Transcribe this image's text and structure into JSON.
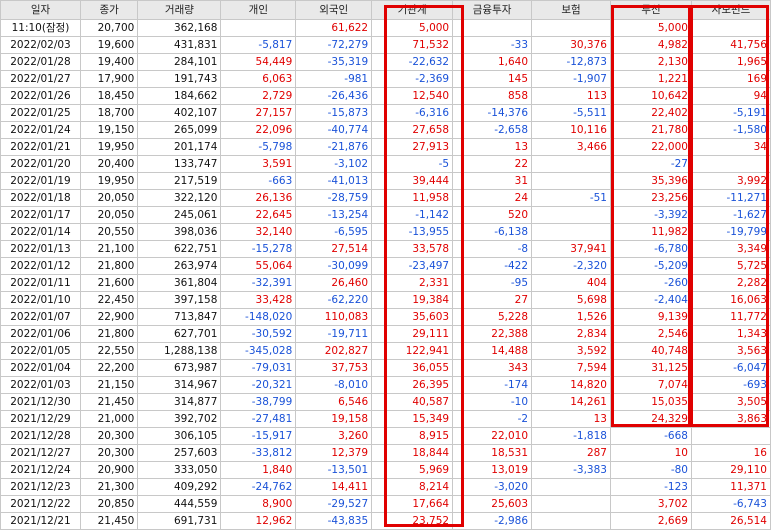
{
  "columns": [
    "일자",
    "종가",
    "거래량",
    "개인",
    "외국인",
    "기관계",
    "금융투자",
    "보험",
    "투신",
    "사모펀드"
  ],
  "rows": [
    [
      "11:10(잠정)",
      "20,700",
      "362,168",
      "",
      "61,622",
      "5,000",
      "",
      "",
      "5,000",
      ""
    ],
    [
      "2022/02/03",
      "19,600",
      "431,831",
      "-5,817",
      "-72,279",
      "71,532",
      "-33",
      "30,376",
      "4,982",
      "41,756"
    ],
    [
      "2022/01/28",
      "19,400",
      "284,101",
      "54,449",
      "-35,319",
      "-22,632",
      "1,640",
      "-12,873",
      "2,130",
      "1,965"
    ],
    [
      "2022/01/27",
      "17,900",
      "191,743",
      "6,063",
      "-981",
      "-2,369",
      "145",
      "-1,907",
      "1,221",
      "169"
    ],
    [
      "2022/01/26",
      "18,450",
      "184,662",
      "2,729",
      "-26,436",
      "12,540",
      "858",
      "113",
      "10,642",
      "94"
    ],
    [
      "2022/01/25",
      "18,700",
      "402,107",
      "27,157",
      "-15,873",
      "-6,316",
      "-14,376",
      "-5,511",
      "22,402",
      "-5,191"
    ],
    [
      "2022/01/24",
      "19,150",
      "265,099",
      "22,096",
      "-40,774",
      "27,658",
      "-2,658",
      "10,116",
      "21,780",
      "-1,580"
    ],
    [
      "2022/01/21",
      "19,950",
      "201,174",
      "-5,798",
      "-21,876",
      "27,913",
      "13",
      "3,466",
      "22,000",
      "34"
    ],
    [
      "2022/01/20",
      "20,400",
      "133,747",
      "3,591",
      "-3,102",
      "-5",
      "22",
      "",
      "-27",
      ""
    ],
    [
      "2022/01/19",
      "19,950",
      "217,519",
      "-663",
      "-41,013",
      "39,444",
      "31",
      "",
      "35,396",
      "3,992"
    ],
    [
      "2022/01/18",
      "20,050",
      "322,120",
      "26,136",
      "-28,759",
      "11,958",
      "24",
      "-51",
      "23,256",
      "-11,271"
    ],
    [
      "2022/01/17",
      "20,050",
      "245,061",
      "22,645",
      "-13,254",
      "-1,142",
      "520",
      "",
      "-3,392",
      "-1,627"
    ],
    [
      "2022/01/14",
      "20,550",
      "398,036",
      "32,140",
      "-6,595",
      "-13,955",
      "-6,138",
      "",
      "11,982",
      "-19,799"
    ],
    [
      "2022/01/13",
      "21,100",
      "622,751",
      "-15,278",
      "27,514",
      "33,578",
      "-8",
      "37,941",
      "-6,780",
      "3,349"
    ],
    [
      "2022/01/12",
      "21,800",
      "263,974",
      "55,064",
      "-30,099",
      "-23,497",
      "-422",
      "-2,320",
      "-5,209",
      "5,725"
    ],
    [
      "2022/01/11",
      "21,600",
      "361,804",
      "-32,391",
      "26,460",
      "2,331",
      "-95",
      "404",
      "-260",
      "2,282"
    ],
    [
      "2022/01/10",
      "22,450",
      "397,158",
      "33,428",
      "-62,220",
      "19,384",
      "27",
      "5,698",
      "-2,404",
      "16,063"
    ],
    [
      "2022/01/07",
      "22,900",
      "713,847",
      "-148,020",
      "110,083",
      "35,603",
      "5,228",
      "1,526",
      "9,139",
      "11,772"
    ],
    [
      "2022/01/06",
      "21,800",
      "627,701",
      "-30,592",
      "-19,711",
      "29,111",
      "22,388",
      "2,834",
      "2,546",
      "1,343"
    ],
    [
      "2022/01/05",
      "22,550",
      "1,288,138",
      "-345,028",
      "202,827",
      "122,941",
      "14,488",
      "3,592",
      "40,748",
      "3,563"
    ],
    [
      "2022/01/04",
      "22,200",
      "673,987",
      "-79,031",
      "37,753",
      "36,055",
      "343",
      "7,594",
      "31,125",
      "-6,047"
    ],
    [
      "2022/01/03",
      "21,150",
      "314,967",
      "-20,321",
      "-8,010",
      "26,395",
      "-174",
      "14,820",
      "7,074",
      "-693"
    ],
    [
      "2021/12/30",
      "21,450",
      "314,877",
      "-38,799",
      "6,546",
      "40,587",
      "-10",
      "14,261",
      "15,035",
      "3,505"
    ],
    [
      "2021/12/29",
      "21,000",
      "392,702",
      "-27,481",
      "19,158",
      "15,349",
      "-2",
      "13",
      "24,329",
      "3,863"
    ],
    [
      "2021/12/28",
      "20,300",
      "306,105",
      "-15,917",
      "3,260",
      "8,915",
      "22,010",
      "-1,818",
      "-668",
      ""
    ],
    [
      "2021/12/27",
      "20,300",
      "257,603",
      "-33,812",
      "12,379",
      "18,844",
      "18,531",
      "287",
      "10",
      "16"
    ],
    [
      "2021/12/24",
      "20,900",
      "333,050",
      "1,840",
      "-13,501",
      "5,969",
      "13,019",
      "-3,383",
      "-80",
      "29,110"
    ],
    [
      "2021/12/23",
      "21,300",
      "409,292",
      "-24,762",
      "14,411",
      "8,214",
      "-3,020",
      "",
      "-123",
      "11,371"
    ],
    [
      "2021/12/22",
      "20,850",
      "444,559",
      "8,900",
      "-29,527",
      "17,664",
      "25,603",
      "",
      "3,702",
      "-6,743"
    ],
    [
      "2021/12/21",
      "21,450",
      "691,731",
      "12,962",
      "-43,835",
      "23,752",
      "-2,986",
      "",
      "2,669",
      "26,514"
    ]
  ],
  "colors": {
    "positive": "#e00000",
    "negative": "#1a52d8",
    "highlight": "#e00000",
    "header_bg": "#e9e9e9"
  }
}
